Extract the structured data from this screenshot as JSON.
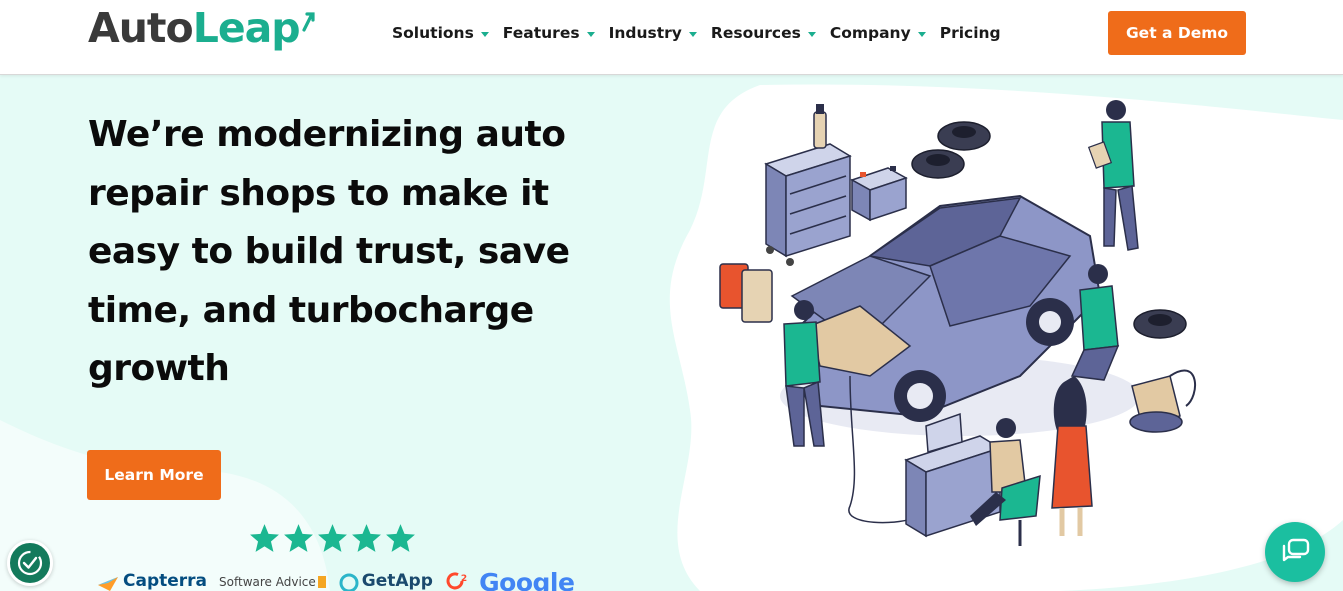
{
  "header": {
    "logo_part1": "Auto",
    "logo_part2": "Leap",
    "nav": [
      {
        "label": "Solutions",
        "has_dropdown": true
      },
      {
        "label": "Features",
        "has_dropdown": true
      },
      {
        "label": "Industry",
        "has_dropdown": true
      },
      {
        "label": "Resources",
        "has_dropdown": true
      },
      {
        "label": "Company",
        "has_dropdown": true
      },
      {
        "label": "Pricing",
        "has_dropdown": false
      }
    ],
    "demo_label": "Get a Demo"
  },
  "hero": {
    "headline_lines": [
      "We’re modernizing auto",
      "repair shops to make it",
      "easy to build trust, save",
      "time, and turbocharge",
      "growth"
    ],
    "cta_label": "Learn More",
    "rating_stars": 5
  },
  "review_logos": [
    {
      "name": "Capterra",
      "text": "Capterra",
      "icon": "capterra-icon"
    },
    {
      "name": "Software Advice",
      "text": "Software Advice",
      "icon": ""
    },
    {
      "name": "GetApp",
      "text": "GetApp",
      "icon": "getapp-icon"
    },
    {
      "name": "G2",
      "text": "2",
      "icon": "g2-icon"
    },
    {
      "name": "Google",
      "text": "Google",
      "icon": ""
    }
  ],
  "widgets": {
    "accessibility_icon": "accessibility-check-icon",
    "chat_icon": "chat-bubble-icon"
  },
  "colors": {
    "brand_green": "#1bae8f",
    "accent_orange": "#ef6c1a",
    "hero_bg": "#e5fbf6",
    "star_green": "#1bb791"
  }
}
